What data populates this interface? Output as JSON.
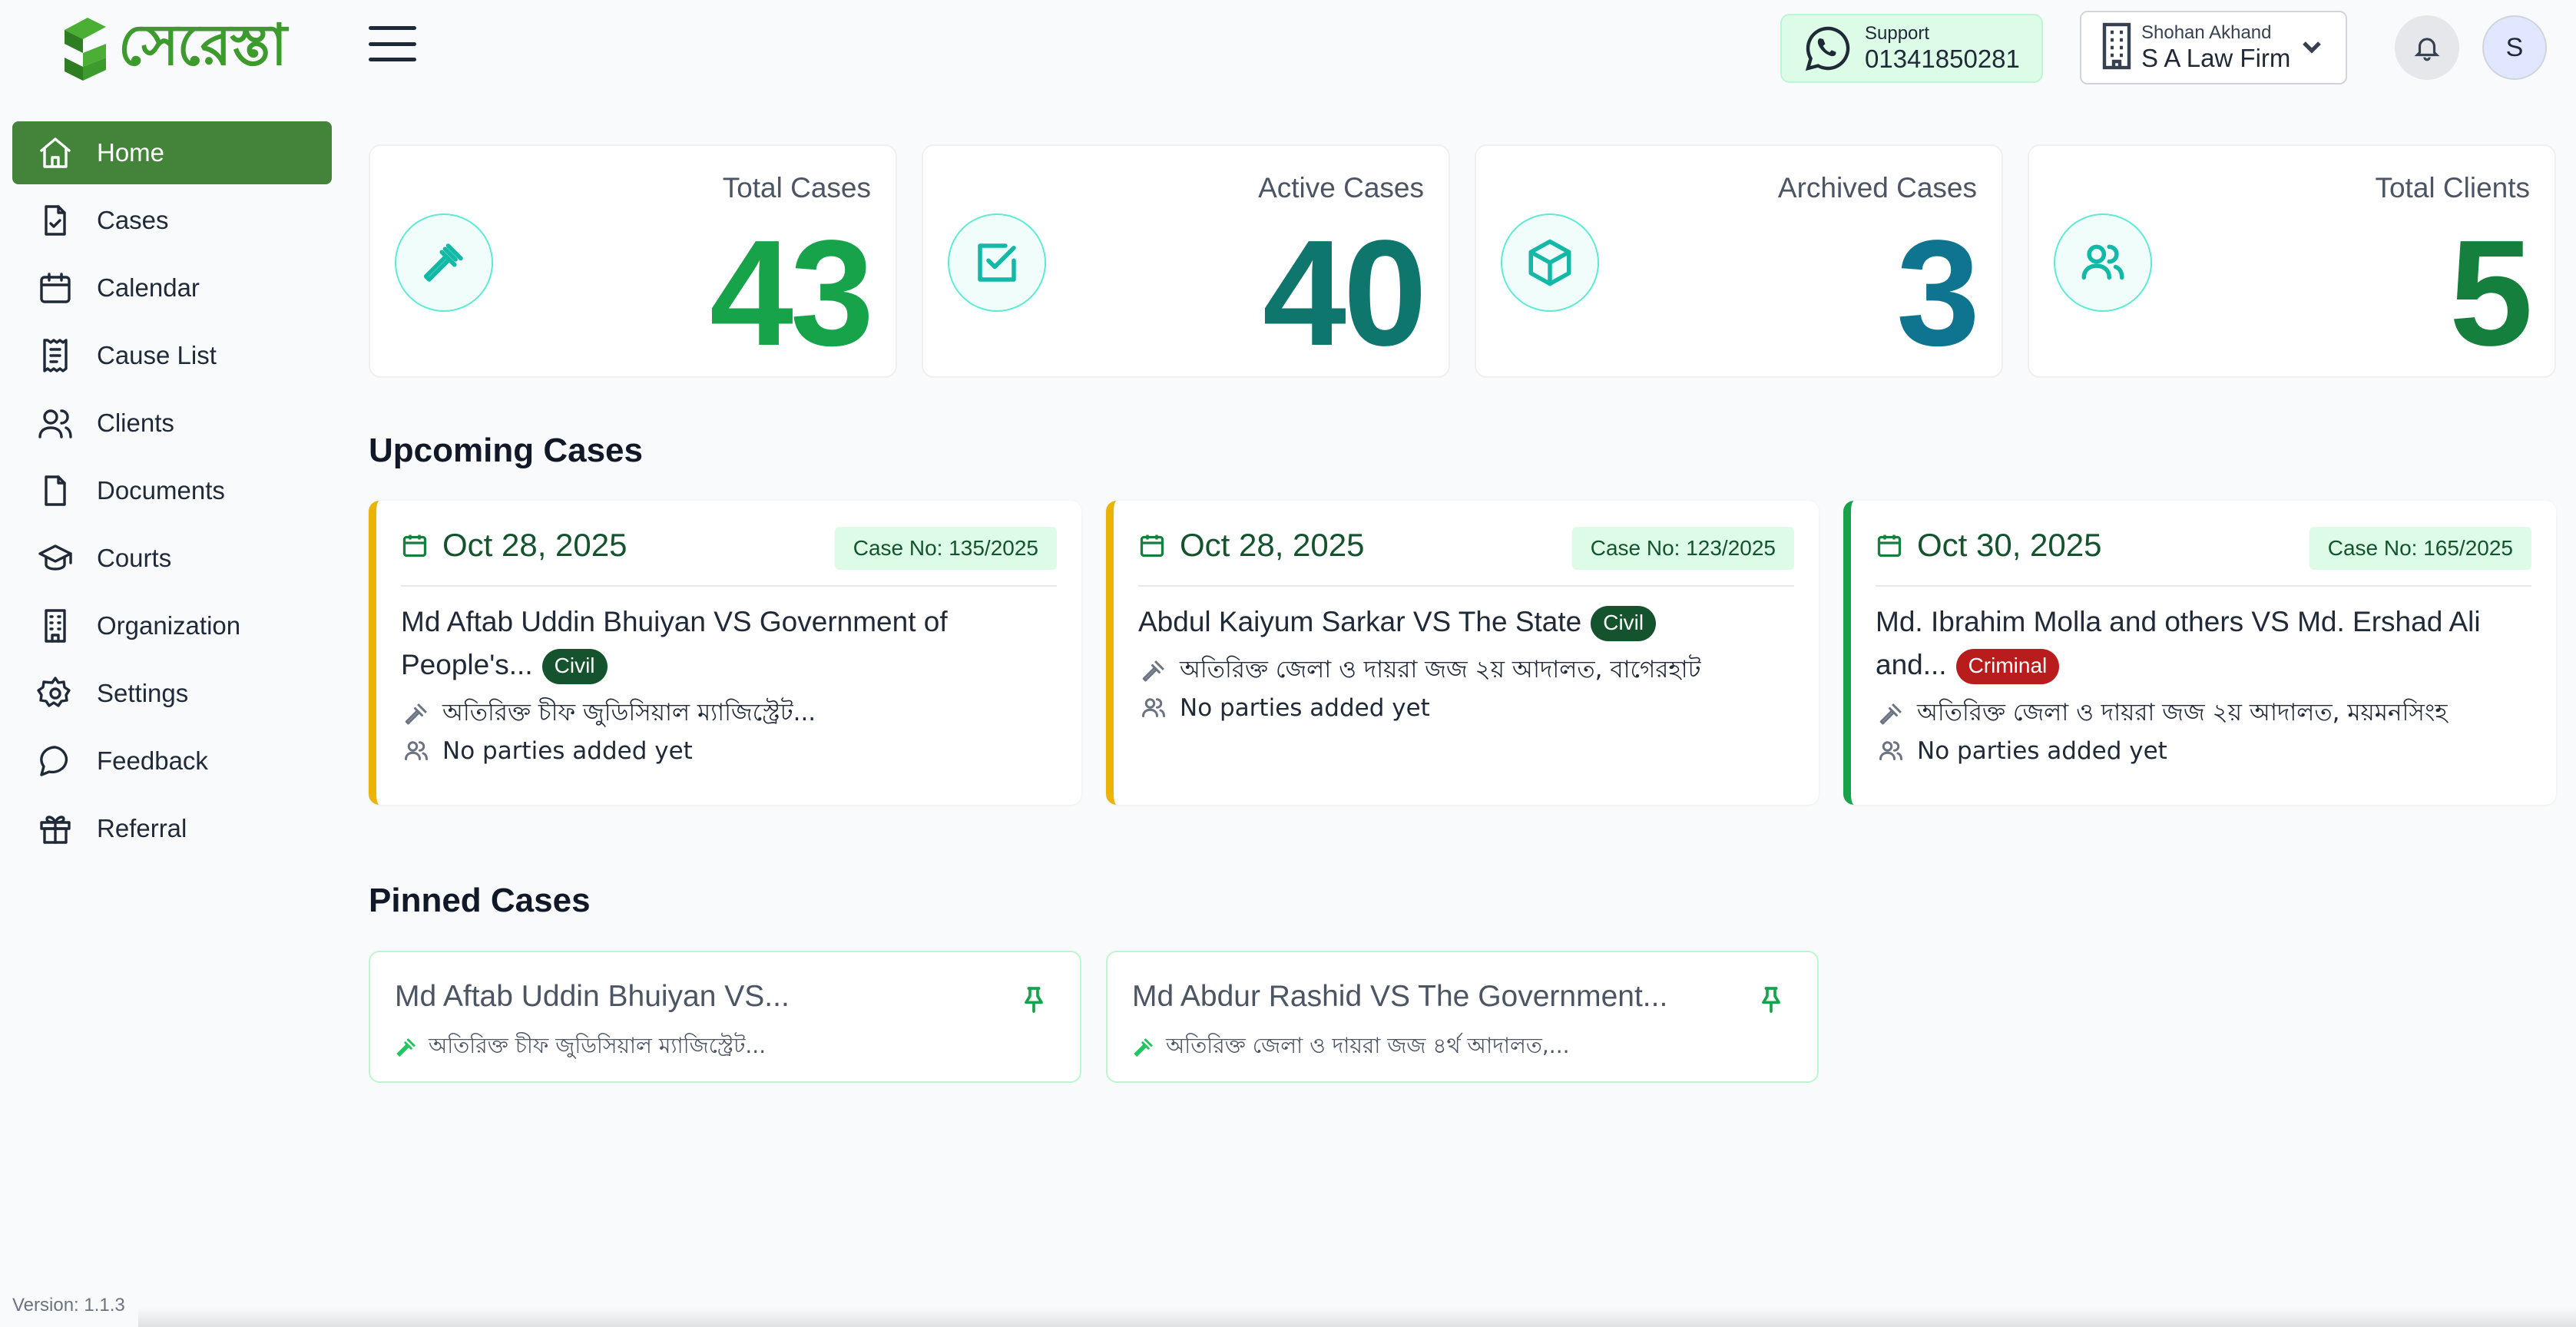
{
  "app": {
    "logo_text": "সেরেস্তা",
    "version": "Version: 1.1.3"
  },
  "nav": [
    {
      "label": "Home",
      "icon": "home-icon",
      "active": true
    },
    {
      "label": "Cases",
      "icon": "file-check-icon"
    },
    {
      "label": "Calendar",
      "icon": "calendar-icon"
    },
    {
      "label": "Cause List",
      "icon": "receipt-icon"
    },
    {
      "label": "Clients",
      "icon": "users-icon"
    },
    {
      "label": "Documents",
      "icon": "file-icon"
    },
    {
      "label": "Courts",
      "icon": "graduation-cap-icon"
    },
    {
      "label": "Organization",
      "icon": "building-icon"
    },
    {
      "label": "Settings",
      "icon": "gear-icon"
    },
    {
      "label": "Feedback",
      "icon": "message-icon"
    },
    {
      "label": "Referral",
      "icon": "gift-icon"
    }
  ],
  "header": {
    "support_label": "Support",
    "support_phone": "01341850281",
    "user_name": "Shohan Akhand",
    "firm_name": "S A Law Firm",
    "avatar_initial": "S"
  },
  "stats": [
    {
      "title": "Total Cases",
      "value": "43",
      "color": "#16a34a",
      "icon": "gavel-icon"
    },
    {
      "title": "Active Cases",
      "value": "40",
      "color": "#0f766e",
      "icon": "check-square-icon"
    },
    {
      "title": "Archived Cases",
      "value": "3",
      "color": "#0e7490",
      "icon": "box-icon"
    },
    {
      "title": "Total Clients",
      "value": "5",
      "color": "#15803d",
      "icon": "users-icon"
    }
  ],
  "upcoming": {
    "heading": "Upcoming Cases",
    "cards": [
      {
        "date": "Oct 28, 2025",
        "case_no": "Case No: 135/2025",
        "title": "Md Aftab Uddin Bhuiyan VS Government of People's...",
        "badge": "Civil",
        "court": "অতিরিক্ত চীফ জুডিসিয়াল ম্যাজিস্ট্রেট...",
        "parties": "No parties added yet",
        "accent": "#eab308"
      },
      {
        "date": "Oct 28, 2025",
        "case_no": "Case No: 123/2025",
        "title": "Abdul Kaiyum Sarkar VS The State",
        "badge": "Civil",
        "court": "অতিরিক্ত জেলা ও দায়রা জজ ২য় আদালত, বাগেরহাট",
        "parties": "No parties added yet",
        "accent": "#eab308"
      },
      {
        "date": "Oct 30, 2025",
        "case_no": "Case No: 165/2025",
        "title": "Md. Ibrahim Molla and others VS Md. Ershad Ali and...",
        "badge": "Criminal",
        "court": "অতিরিক্ত জেলা ও দায়রা জজ ২য় আদালত, ময়মনসিংহ",
        "parties": "No parties added yet",
        "accent": "#16a34a"
      }
    ]
  },
  "pinned": {
    "heading": "Pinned Cases",
    "cards": [
      {
        "title": "Md Aftab Uddin Bhuiyan VS...",
        "court": "অতিরিক্ত চীফ জুডিসিয়াল ম্যাজিস্ট্রেট..."
      },
      {
        "title": "Md Abdur Rashid VS The Government...",
        "court": "অতিরিক্ত জেলা ও দায়রা জজ ৪র্থ আদালত,..."
      }
    ]
  }
}
